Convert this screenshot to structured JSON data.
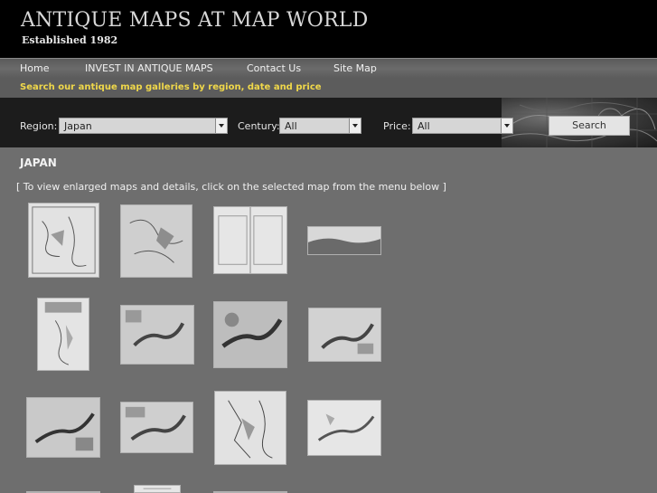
{
  "header": {
    "title": "ANTIQUE MAPS AT MAP WORLD",
    "subtitle": "Established 1982"
  },
  "nav": {
    "items": [
      {
        "label": "Home"
      },
      {
        "label": "INVEST IN ANTIQUE MAPS"
      },
      {
        "label": "Contact Us"
      },
      {
        "label": "Site Map"
      }
    ]
  },
  "tagline": "Search our antique map galleries by region, date and price",
  "search": {
    "region_label": "Region:",
    "region_value": "Japan",
    "century_label": "Century:",
    "century_value": "All",
    "price_label": "Price:",
    "price_value": "All",
    "button_label": "Search"
  },
  "gallery": {
    "heading": "JAPAN",
    "instructions": "[ To view enlarged maps and details, click on the selected map from the menu below ]"
  }
}
